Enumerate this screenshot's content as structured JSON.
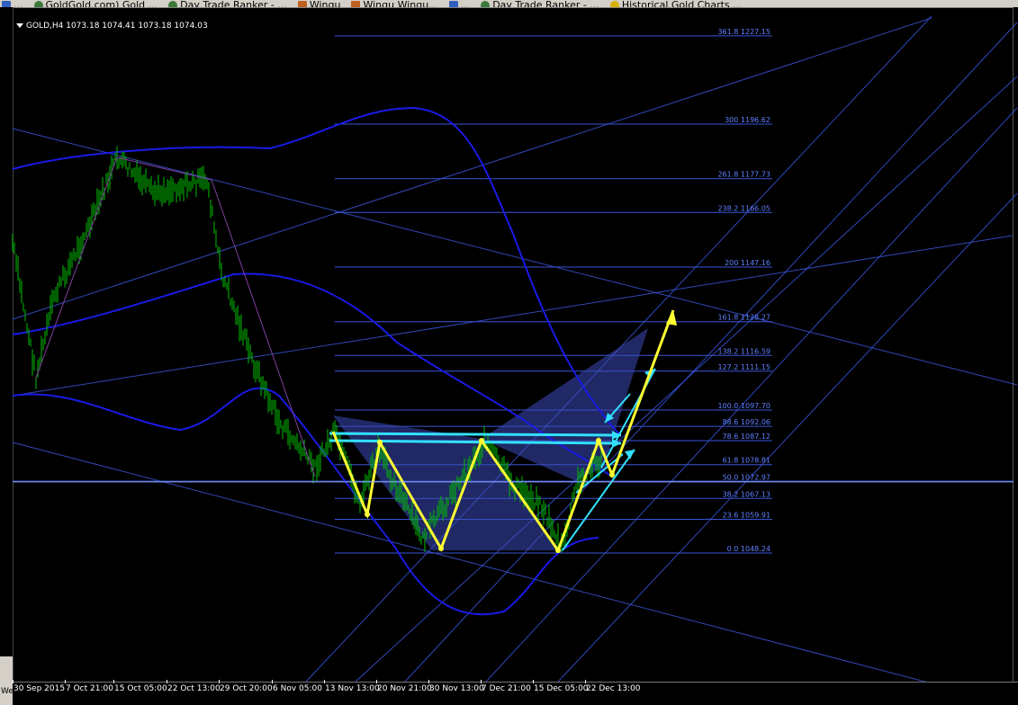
{
  "tabs": [
    {
      "label": "...",
      "icon": "app-icon"
    },
    {
      "label": "GoldGold.com) Gold ...",
      "icon": "globe-icon"
    },
    {
      "label": "Day Trade Ranker - ...",
      "icon": "globe-icon"
    },
    {
      "label": "Wingu",
      "icon": "image-icon"
    },
    {
      "label": "Wingu Wingu...",
      "icon": "document-icon"
    },
    {
      "label": "...",
      "icon": "chart-icon"
    },
    {
      "label": "Day Trade Ranker - ...",
      "icon": "globe-icon"
    },
    {
      "label": "Historical Gold Charts ...",
      "icon": "star-icon"
    }
  ],
  "chart": {
    "title": "GOLD,H4  1073.18 1074.41 1073.18 1074.03",
    "x_labels": [
      "30 Sep 2015",
      "7 Oct 21:00",
      "15 Oct 05:00",
      "22 Oct 13:00",
      "29 Oct 20:00",
      "6 Nov 05:00",
      "13 Nov 13:00",
      "20 Nov 21:00",
      "30 Nov 13:00",
      "7 Dec 21:00",
      "15 Dec 05:00",
      "22 Dec 13:00"
    ],
    "fib_levels": [
      {
        "label": "361.8  1227.15",
        "price": 1227.15
      },
      {
        "label": "300  1196.62",
        "price": 1196.62
      },
      {
        "label": "261.8  1177.73",
        "price": 1177.73
      },
      {
        "label": "238.2  1166.05",
        "price": 1166.05
      },
      {
        "label": "200  1147.16",
        "price": 1147.16
      },
      {
        "label": "161.8  1128.27",
        "price": 1128.27
      },
      {
        "label": "138.2  1116.59",
        "price": 1116.59
      },
      {
        "label": "127.2  1111.15",
        "price": 1111.15
      },
      {
        "label": "100.0  1097.70",
        "price": 1097.7
      },
      {
        "label": "88.6  1092.06",
        "price": 1092.06
      },
      {
        "label": "78.6  1087.12",
        "price": 1087.12
      },
      {
        "label": "61.8  1078.81",
        "price": 1078.81
      },
      {
        "label": "50.0  1072.97",
        "price": 1072.97
      },
      {
        "label": "38.2  1067.13",
        "price": 1067.13
      },
      {
        "label": "23.6  1059.91",
        "price": 1059.91
      },
      {
        "label": "0.0  1048.24",
        "price": 1048.24
      }
    ],
    "bid_price": 1073.18,
    "colors": {
      "background": "#000000",
      "candles": "#00c000",
      "bands": "#1a1ae6",
      "grid_lines": "#3a55d8",
      "arrows_yellow": "#ffff33",
      "arrows_cyan": "#33e0ff",
      "pattern_fill": "#3a4bb8",
      "fib_text": "#6080ff"
    }
  },
  "bottom_left_stub": "We"
}
